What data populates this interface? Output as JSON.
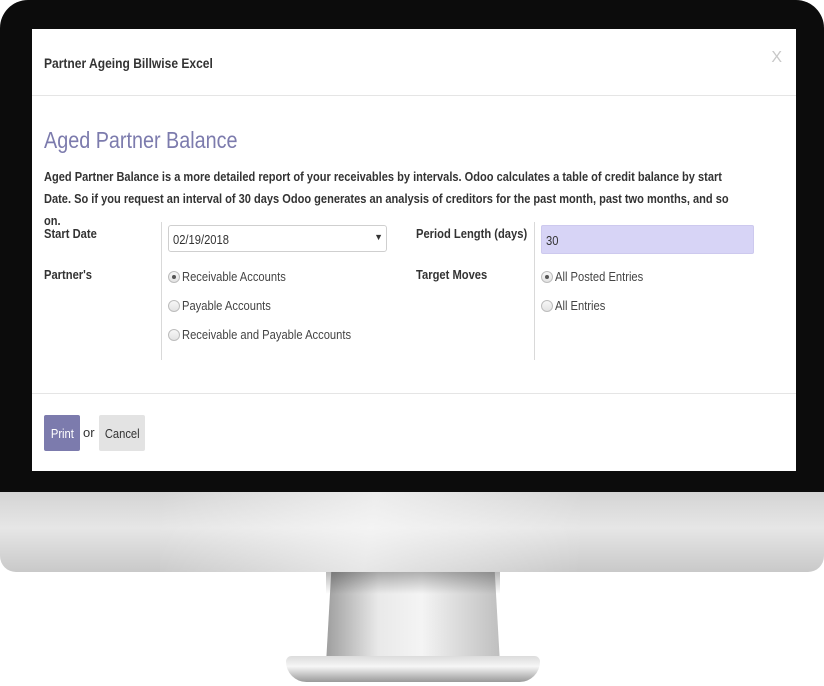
{
  "dialog": {
    "title": "Partner Ageing Billwise Excel",
    "close_label": "X"
  },
  "form": {
    "title": "Aged Partner Balance",
    "description": "Aged Partner Balance is a more detailed report of your receivables by intervals. Odoo calculates a table of credit balance by start Date. So if you request an interval of 30 days Odoo generates an analysis of creditors for the past month, past two months, and so on.",
    "start_date_label": "Start Date",
    "start_date_value": "02/19/2018",
    "period_length_label": "Period Length (days)",
    "period_length_value": "30",
    "partners_label": "Partner's",
    "partner_options": [
      {
        "label": "Receivable Accounts",
        "selected": true
      },
      {
        "label": "Payable Accounts",
        "selected": false
      },
      {
        "label": "Receivable and Payable Accounts",
        "selected": false
      }
    ],
    "target_moves_label": "Target Moves",
    "target_move_options": [
      {
        "label": "All Posted Entries",
        "selected": true
      },
      {
        "label": "All Entries",
        "selected": false
      }
    ]
  },
  "footer": {
    "print_label": "Print",
    "or_label": "or",
    "cancel_label": "Cancel"
  },
  "colors": {
    "accent": "#7c7bad",
    "input_highlight": "#d7d4f6"
  }
}
